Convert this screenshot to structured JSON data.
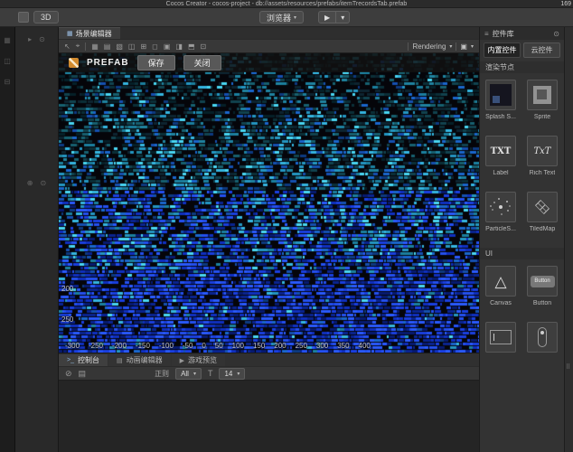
{
  "titlebar": {
    "title": "Cocos Creator - cocos-project - db://assets/resources/prefabs/itemTrecordsTab.prefab",
    "right_text": "169"
  },
  "toolbar": {
    "mode_3d": "3D",
    "browser": "浏览器",
    "play": "▶",
    "caret": "▾"
  },
  "strips": {
    "a": [
      "▦",
      "◫",
      "⊟"
    ],
    "b_top": [
      "▸",
      "⊙"
    ],
    "b_mid": [
      "⊕",
      "⊙"
    ]
  },
  "scene": {
    "tab": "场景编辑器",
    "tab_icon": "▦",
    "left_tools": [
      "↖",
      "⌖"
    ],
    "toolbar_icons": [
      "▦",
      "▤",
      "▧",
      "◫",
      "⊞",
      "◻",
      "▣",
      "◨",
      "⬒",
      "⊡"
    ],
    "rendering_label": "Rendering",
    "camera_icon": "▣",
    "caret": "▾",
    "prefab": {
      "label": "PREFAB",
      "save": "保存",
      "close": "关闭"
    },
    "ruler_h": [
      "-300",
      "-250",
      "-200",
      "-150",
      "-100",
      "-50",
      "0",
      "50",
      "100",
      "150",
      "200",
      "250",
      "300",
      "350",
      "400"
    ],
    "ruler_v": [
      "200",
      "250"
    ],
    "glitch": {
      "background": "#05050a",
      "palette_top": [
        "#0b2f38",
        "#11434f",
        "#17606f",
        "#1f83a0",
        "#0d2430",
        "#052028"
      ],
      "palette_mid": [
        "#1b7f9e",
        "#2496c2",
        "#35b5e0",
        "#1550b0",
        "#1a66cc",
        "#0d3a80",
        "#49d6f2"
      ],
      "palette_bottom": [
        "#1030c0",
        "#1a3fe0",
        "#2450f0",
        "#0a2490",
        "#2a5aff",
        "#071a70"
      ]
    }
  },
  "widgets": {
    "title": "控件库",
    "menu_icon": "≡",
    "pin_icon": "⊙",
    "tabs": [
      {
        "label": "内置控件"
      },
      {
        "label": "云控件"
      }
    ],
    "sections": [
      {
        "label": "渲染节点",
        "items": [
          {
            "name": "Splash S...",
            "icon": "splash"
          },
          {
            "name": "Sprite",
            "icon": "sprite"
          },
          {
            "name": "Label",
            "icon": "label",
            "glyph": "TXT"
          },
          {
            "name": "Rich Text",
            "icon": "rich-text",
            "glyph": "TxT"
          },
          {
            "name": "ParticleS...",
            "icon": "particle-system"
          },
          {
            "name": "TiledMap",
            "icon": "tiled-map"
          }
        ]
      },
      {
        "label": "UI",
        "items": [
          {
            "name": "Canvas",
            "icon": "canvas",
            "glyph": "△"
          },
          {
            "name": "Button",
            "icon": "button",
            "glyph": "Button"
          },
          {
            "name": "",
            "icon": "edit-box"
          },
          {
            "name": "",
            "icon": "slider"
          }
        ]
      }
    ]
  },
  "console": {
    "tabs": [
      {
        "label": "控制台",
        "icon": ">_"
      },
      {
        "label": "动画编辑器",
        "icon": "▤"
      },
      {
        "label": "游戏预览",
        "icon": "▶"
      }
    ],
    "clear_icon": "⊘",
    "doc_icon": "▤",
    "regex_label": "正则",
    "filter_value": "All",
    "fontsize_icon": "T",
    "fontsize_value": "14",
    "caret": "▾"
  },
  "right_strip": {
    "drag_icon": "⠿"
  }
}
